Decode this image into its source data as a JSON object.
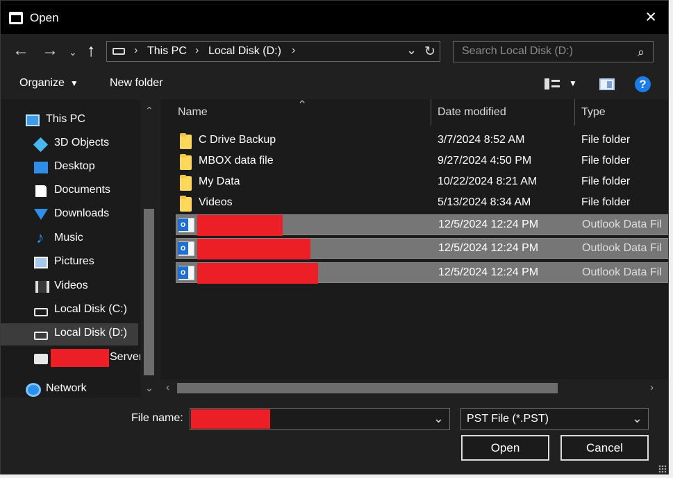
{
  "window": {
    "title": "Open"
  },
  "navigation": {
    "breadcrumbs": [
      "This PC",
      "Local Disk (D:)"
    ],
    "search_placeholder": "Search Local Disk (D:)"
  },
  "toolbar": {
    "organize_label": "Organize",
    "new_folder_label": "New folder",
    "help_label": "?"
  },
  "sidebar": {
    "items": [
      {
        "label": "This PC",
        "icon": "computer-icon"
      },
      {
        "label": "3D Objects",
        "icon": "cube-icon"
      },
      {
        "label": "Desktop",
        "icon": "desktop-icon"
      },
      {
        "label": "Documents",
        "icon": "document-icon"
      },
      {
        "label": "Downloads",
        "icon": "download-icon"
      },
      {
        "label": "Music",
        "icon": "music-icon"
      },
      {
        "label": "Pictures",
        "icon": "pictures-icon"
      },
      {
        "label": "Videos",
        "icon": "videos-icon"
      },
      {
        "label": "Local Disk (C:)",
        "icon": "drive-icon"
      },
      {
        "label": "Local Disk (D:)",
        "icon": "drive-icon",
        "selected": true
      },
      {
        "label": "Server",
        "icon": "server-icon",
        "redacted": true
      },
      {
        "label": "Network",
        "icon": "network-icon"
      }
    ]
  },
  "file_list": {
    "columns": [
      "Name",
      "Date modified",
      "Type"
    ],
    "rows": [
      {
        "name": "C Drive Backup",
        "date": "3/7/2024 8:52 AM",
        "type": "File folder",
        "icon": "folder-icon"
      },
      {
        "name": "MBOX data file",
        "date": "9/27/2024 4:50 PM",
        "type": "File folder",
        "icon": "folder-icon"
      },
      {
        "name": "My Data",
        "date": "10/22/2024 8:21 AM",
        "type": "File folder",
        "icon": "folder-icon"
      },
      {
        "name": "Videos",
        "date": "5/13/2024 8:34 AM",
        "type": "File folder",
        "icon": "folder-icon"
      },
      {
        "name": "",
        "date": "12/5/2024 12:24 PM",
        "type": "Outlook Data Fil",
        "icon": "outlook-data-file-icon",
        "selected": true,
        "redacted": true
      },
      {
        "name": "",
        "date": "12/5/2024 12:24 PM",
        "type": "Outlook Data Fil",
        "icon": "outlook-data-file-icon",
        "selected": true,
        "redacted": true
      },
      {
        "name": "",
        "date": "12/5/2024 12:24 PM",
        "type": "Outlook Data Fil",
        "icon": "outlook-data-file-icon",
        "selected": true,
        "redacted": true
      }
    ]
  },
  "footer": {
    "file_name_label": "File name:",
    "file_name_value": "",
    "file_type_filter": "PST File (*.PST)",
    "open_label": "Open",
    "cancel_label": "Cancel"
  },
  "colors": {
    "background": "#202020",
    "selection": "#767676",
    "redaction": "#ec1f26",
    "accent": "#1b7de8"
  }
}
